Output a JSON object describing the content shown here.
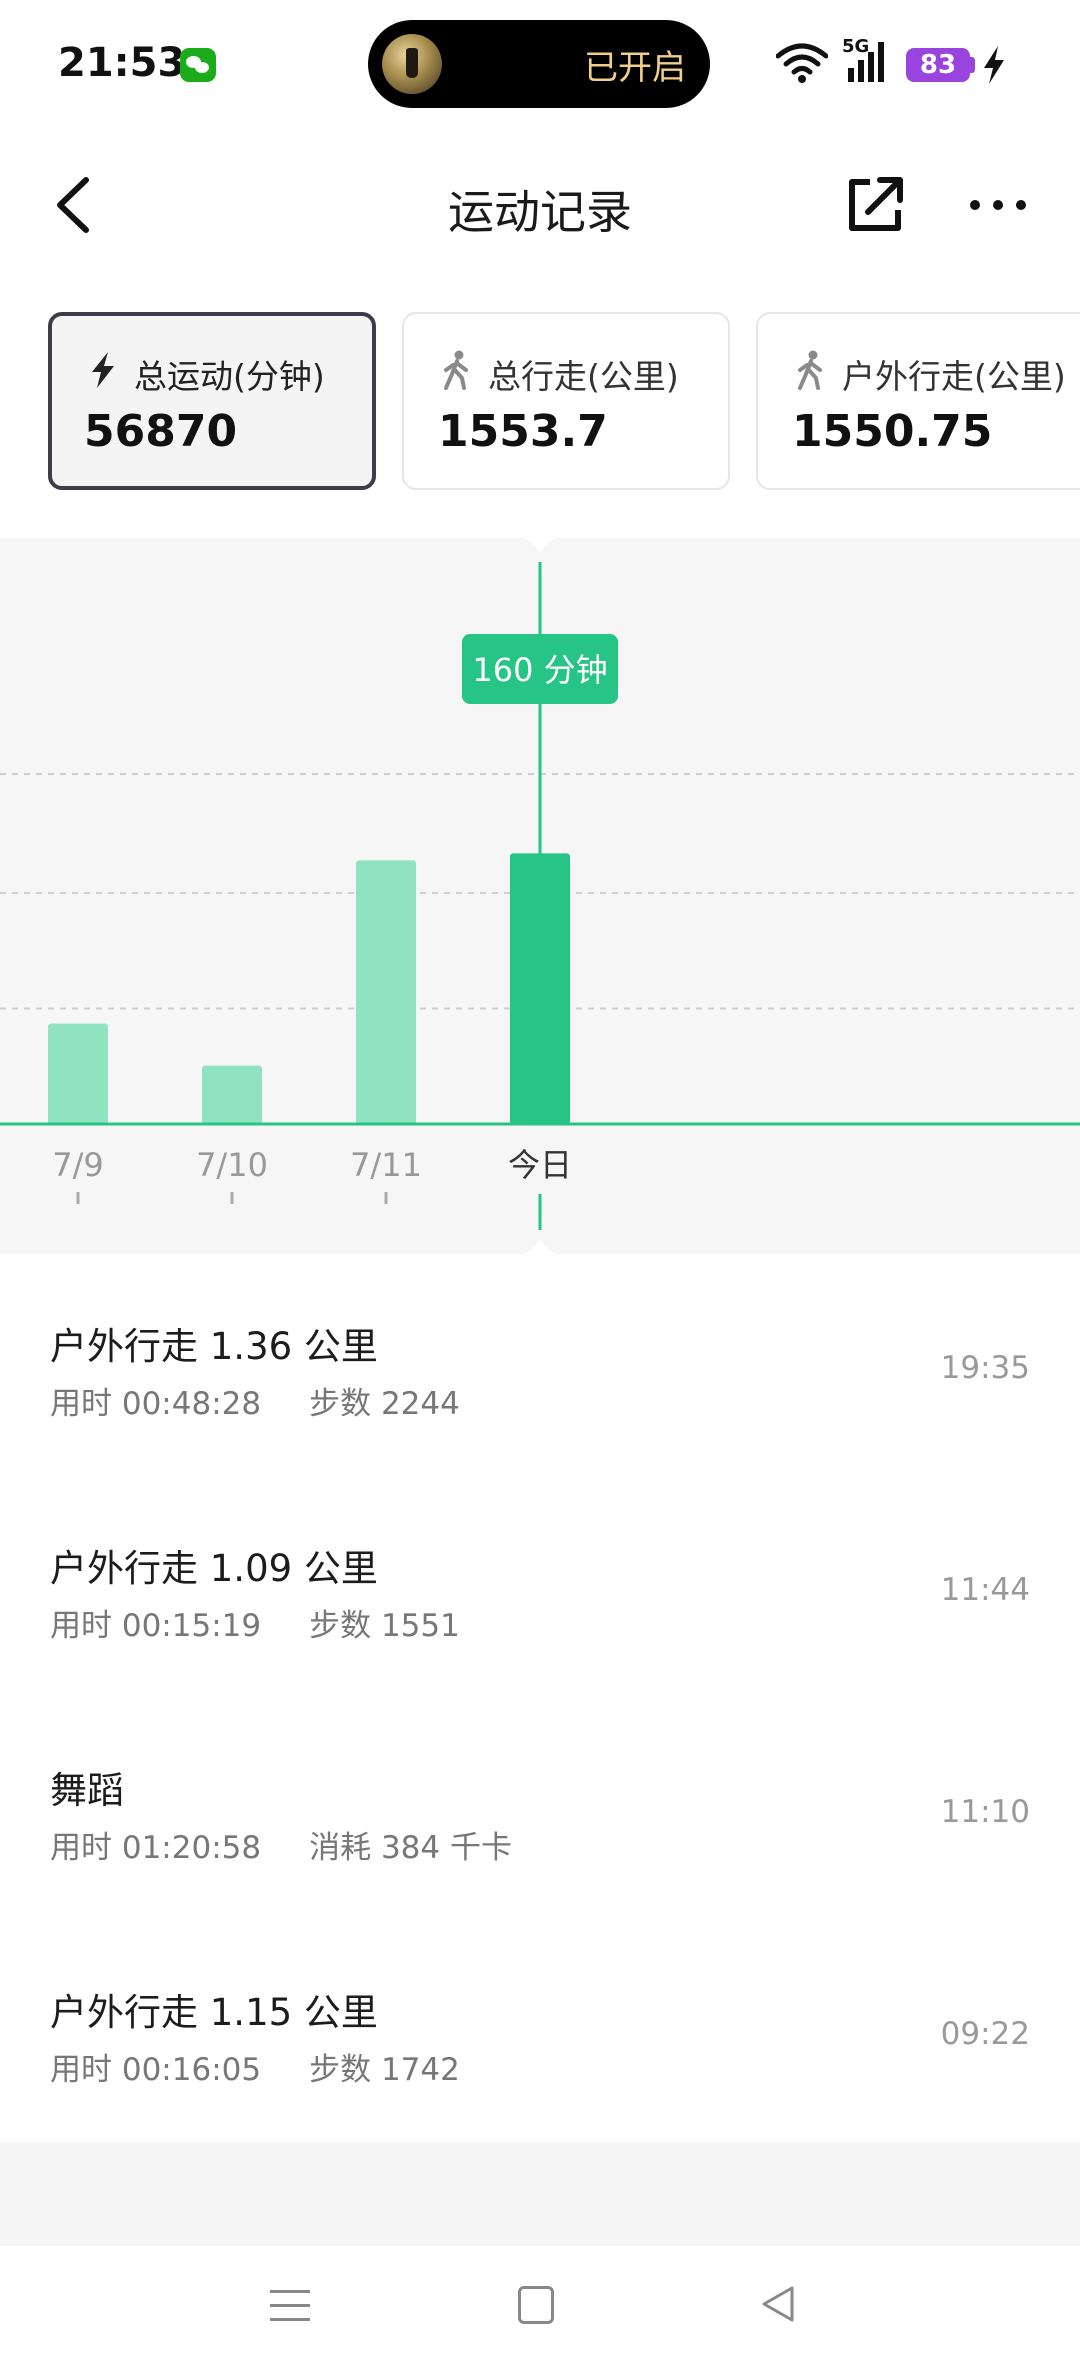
{
  "status_bar": {
    "time": "21:53",
    "island_text": "已开启",
    "network": "5G",
    "battery": "83",
    "icons": [
      "wechat-icon",
      "flashlight-icon",
      "wifi-icon",
      "signal-icon",
      "charging-icon"
    ]
  },
  "nav": {
    "title": "运动记录",
    "icons": [
      "back-arrow-icon",
      "share-icon",
      "more-icon"
    ]
  },
  "cards": [
    {
      "label": "总运动(分钟)",
      "value": "56870",
      "icon": "lightning-icon",
      "selected": true
    },
    {
      "label": "总行走(公里)",
      "value": "1553.7",
      "icon": "walking-icon",
      "selected": false
    },
    {
      "label": "户外行走(公里)",
      "value": "1550.75",
      "icon": "walking-icon",
      "selected": false
    }
  ],
  "chart_data": {
    "type": "bar",
    "categories": [
      "7/9",
      "7/10",
      "7/11",
      "今日"
    ],
    "values": [
      43,
      25,
      113,
      116
    ],
    "selected_index": 3,
    "tooltip": "160 分钟",
    "ylim": [
      0,
      150
    ],
    "grid": true,
    "colors": {
      "bar": "#8fe3c1",
      "selected": "#26c485",
      "axis": "#26c485",
      "grid": "#d0d0d0"
    }
  },
  "records": [
    {
      "title": "户外行走 1.36 公里",
      "duration": "用时 00:48:28",
      "extra": "步数 2244",
      "time": "19:35"
    },
    {
      "title": "户外行走 1.09 公里",
      "duration": "用时 00:15:19",
      "extra": "步数 1551",
      "time": "11:44"
    },
    {
      "title": "舞蹈",
      "duration": "用时 01:20:58",
      "extra": "消耗 384 千卡",
      "time": "11:10"
    },
    {
      "title": "户外行走 1.15 公里",
      "duration": "用时 00:16:05",
      "extra": "步数 1742",
      "time": "09:22"
    }
  ],
  "system_nav": {
    "icons": [
      "menu-icon",
      "home-icon",
      "back-triangle-icon"
    ]
  }
}
